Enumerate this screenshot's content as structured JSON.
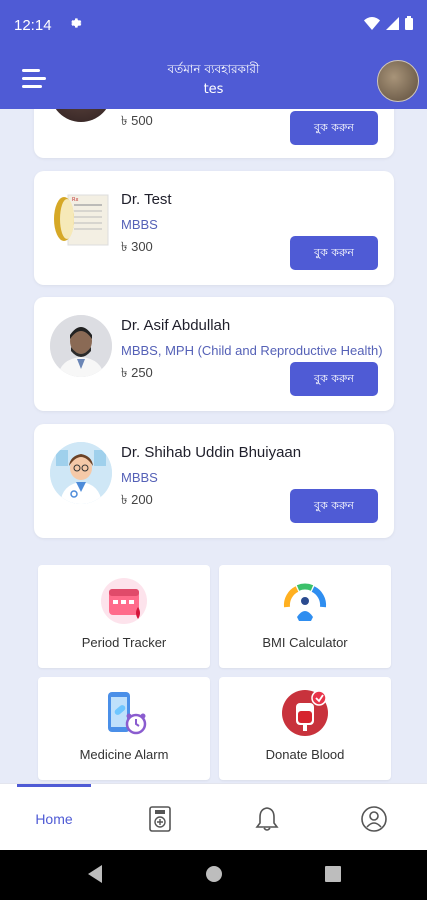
{
  "status_bar": {
    "time": "12:14",
    "icons": [
      "settings-icon",
      "wifi-icon",
      "signal-icon",
      "battery-icon"
    ]
  },
  "header": {
    "title": "বর্তমান ব্যবহারকারী",
    "user": "tes"
  },
  "doctors": [
    {
      "name": "",
      "degree": "",
      "fee": "৳ 500",
      "book_label": "বুক করুন"
    },
    {
      "name": "Dr. Test",
      "degree": "MBBS",
      "fee": "৳ 300",
      "book_label": "বুক করুন"
    },
    {
      "name": "Dr.  Asif Abdullah",
      "degree": "MBBS, MPH (Child and Reproductive Health)",
      "fee": "৳ 250",
      "book_label": "বুক করুন"
    },
    {
      "name": "Dr. Shihab Uddin Bhuiyaan",
      "degree": "MBBS",
      "fee": "৳ 200",
      "book_label": "বুক করুন"
    }
  ],
  "tools": [
    {
      "label": "Period Tracker",
      "icon": "calendar-drop-icon"
    },
    {
      "label": "BMI Calculator",
      "icon": "bmi-gauge-icon"
    },
    {
      "label": "Medicine Alarm",
      "icon": "phone-pill-alarm-icon"
    },
    {
      "label": "Donate Blood",
      "icon": "blood-bag-icon"
    }
  ],
  "bottom_nav": {
    "home_label": "Home",
    "icons": [
      "prescription-icon",
      "bell-icon",
      "profile-icon"
    ]
  },
  "colors": {
    "primary": "#4f5bd5",
    "background": "#e7ebf8",
    "degree_text": "#5561b7"
  }
}
